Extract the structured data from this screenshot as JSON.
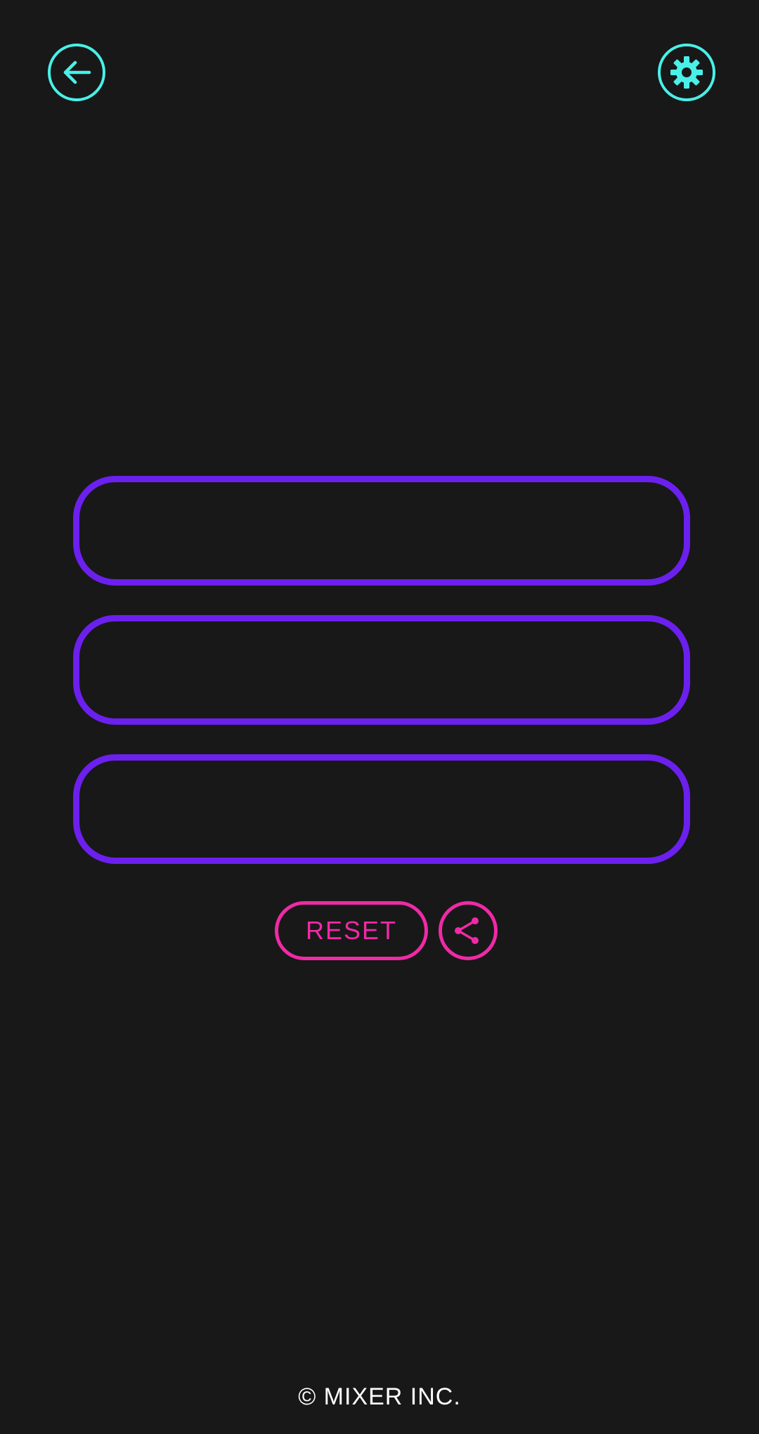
{
  "header": {
    "back_icon": "arrow-left-icon",
    "settings_icon": "gear-icon"
  },
  "fields": [
    {
      "value": ""
    },
    {
      "value": ""
    },
    {
      "value": ""
    }
  ],
  "actions": {
    "reset_label": "RESET",
    "share_icon": "share-icon"
  },
  "footer": {
    "copyright": "© MIXER INC."
  },
  "colors": {
    "background": "#181818",
    "accent_cyan": "#49f0e8",
    "accent_purple": "#6c20ee",
    "accent_pink": "#f02aa6",
    "text_white": "#ffffff"
  }
}
